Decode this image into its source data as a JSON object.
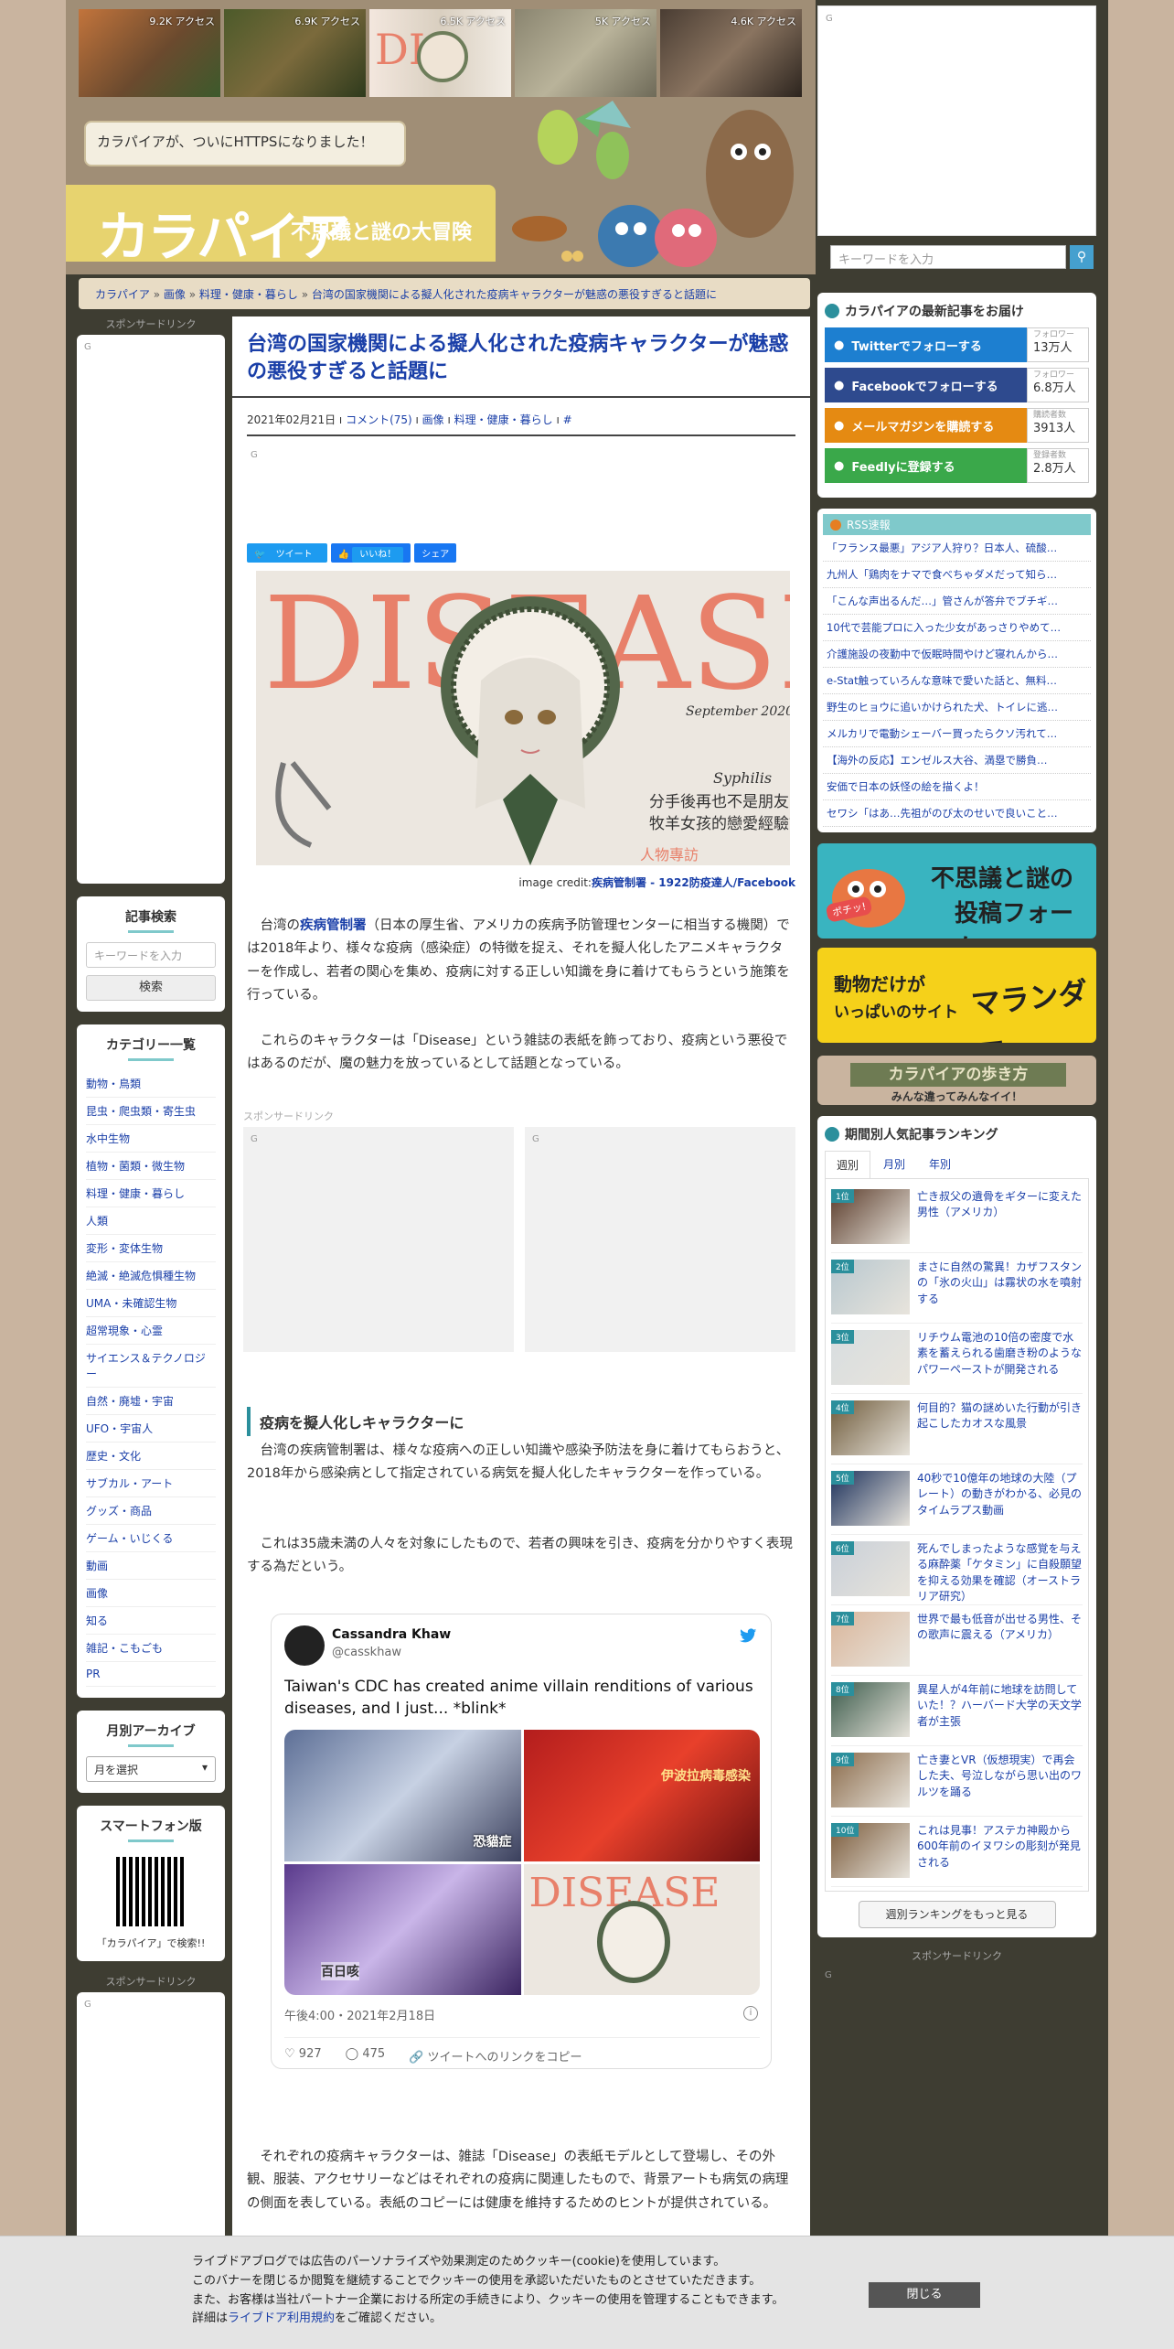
{
  "header": {
    "thumbs": [
      "9.2K アクセス",
      "6.9K アクセス",
      "6.5K アクセス",
      "5K アクセス",
      "4.6K アクセス"
    ],
    "bubble": "カラパイアが、ついにHTTPSになりました！",
    "logo": "カラパイア",
    "tagline": "不思議と謎の大冒険",
    "ad_g": "G",
    "search_placeholder": "キーワードを入力"
  },
  "breadcrumb": [
    "カラパイア",
    "画像",
    "料理・健康・暮らし",
    "台湾の国家機関による擬人化された疫病キャラクターが魅惑の悪役すぎると話題に"
  ],
  "left": {
    "sponsor": "スポンサードリンク",
    "ad_g": "G",
    "search_title": "記事検索",
    "search_placeholder": "キーワードを入力",
    "search_button": "検索",
    "category_title": "カテゴリー一覧",
    "categories": [
      "動物・鳥類",
      "昆虫・爬虫類・寄生虫",
      "水中生物",
      "植物・菌類・微生物",
      "料理・健康・暮らし",
      "人類",
      "変形・変体生物",
      "絶滅・絶滅危惧種生物",
      "UMA・未確認生物",
      "超常現象・心霊",
      "サイエンス＆テクノロジー",
      "自然・廃墟・宇宙",
      "UFO・宇宙人",
      "歴史・文化",
      "サブカル・アート",
      "グッズ・商品",
      "ゲーム・いじくる",
      "動画",
      "画像",
      "知る",
      "雑記・こもごも",
      "PR"
    ],
    "archive_title": "月別アーカイブ",
    "archive_select": "月を選択",
    "sp_title": "スマートフォン版",
    "sp_caption": "「カラパイア」で検索!!",
    "sponsor2": "スポンサードリンク"
  },
  "article": {
    "title": "台湾の国家機関による擬人化された疫病キャラクターが魅惑の悪役すぎると話題に",
    "date": "2021年02月21日",
    "comments": "コメント(75)",
    "cat1": "画像",
    "cat2": "料理・健康・暮らし",
    "hash": "#",
    "ad_g": "G",
    "tweet_btn": "ツイート",
    "like_btn": "いいね！",
    "share_btn": "シェア",
    "cover_title": "DISEASE",
    "cover_date": "September 2020",
    "cover_name": "Syphilis",
    "cover_line1": "分手後再也不是朋友",
    "cover_line2": "牧羊女孩的戀愛經驗談",
    "cover_tag": "人物專訪",
    "credit_prefix": "image credit:",
    "credit_link": "疾病管制署 - 1922防疫達人/Facebook",
    "p1_pre": "台湾の",
    "p1_link": "疾病管制署",
    "p1_rest": "（日本の厚生省、アメリカの疾病予防管理センターに相当する機関）では2018年より、様々な疫病（感染症）の特徴を捉え、それを擬人化したアニメキャラクターを作成し、若者の関心を集め、疫病に対する正しい知識を身に着けてもらうという施策を行っている。",
    "p2": "これらのキャラクターは「Disease」という雑誌の表紙を飾っており、疫病という悪役ではあるのだが、魔の魅力を放っているとして話題となっている。",
    "sponsor": "スポンサードリンク",
    "section": "疫病を擬人化しキャラクターに",
    "p3": "台湾の疾病管制署は、様々な疫病への正しい知識や感染予防法を身に着けてもらおうと、2018年から感染病として指定されている病気を擬人化したキャラクターを作っている。",
    "p4": "これは35歳未満の人々を対象にしたもので、若者の興味を引き、疫病を分かりやすく表現する為だという。",
    "p5": "それぞれの疫病キャラクターは、雑誌「Disease」の表紙モデルとして登場し、その外観、服装、アクセサリーなどはそれぞれの疫病に関連したもので、背景アートも病気の病理の側面を表している。表紙のコピーには健康を維持するためのヒントが提供されている。"
  },
  "tweet": {
    "name": "Cassandra Khaw",
    "handle": "@casskhaw",
    "text": "Taiwan's CDC has created anime villain renditions of various diseases, and I just... *blink*",
    "date": "午後4:00・2021年2月18日",
    "likes": "927",
    "replies": "475",
    "copy": "ツイートへのリンクをコピー",
    "img_text1": "恐貓症",
    "img_text2": "伊波拉病毒感染",
    "img_text3": "百日咳",
    "img_text4": "DISEASE"
  },
  "right": {
    "follow_title": "カラパイアの最新記事をお届け",
    "follow": [
      {
        "label": "Twitterでフォローする",
        "sub": "フォロワー",
        "count": "13万人",
        "color": "#1d7fd0"
      },
      {
        "label": "Facebookでフォローする",
        "sub": "フォロワー",
        "count": "6.8万人",
        "color": "#2e4a8e"
      },
      {
        "label": "メールマガジンを購読する",
        "sub": "購読者数",
        "count": "3913人",
        "color": "#e58a12"
      },
      {
        "label": "Feedlyに登録する",
        "sub": "登録者数",
        "count": "2.8万人",
        "color": "#3aa84a"
      }
    ],
    "rss_title": "RSS速報",
    "rss": [
      "「フランス最悪」アジア人狩り？日本人、硫酸…",
      "九州人「鶏肉をナマで食べちゃダメだって知ら…",
      "「こんな声出るんだ…」管さんが答弁でブチギ…",
      "10代で芸能プロに入った少女があっさりやめて…",
      "介護施設の夜勤中で仮眠時間やけど寝れんから…",
      "e-Stat触っていろんな意味で愛いた話と、無料…",
      "野生のヒョウに追いかけられた犬、トイレに逃…",
      "メルカリで電動シェーバー買ったらクソ汚れて…",
      "【海外の反応】エンゼルス大谷、満塁で勝負…",
      "安価で日本の妖怪の絵を描くよ！",
      "セワシ「はあ…先祖がのび太のせいで良いこと…"
    ],
    "banner1_line1": "不思議と謎の",
    "banner1_line2": "投稿フォーム",
    "banner1_badge": "ポチッ!",
    "banner2_line1": "動物だけが",
    "banner2_line2": "いっぱいのサイト",
    "banner2_logo": "マランダー",
    "walk_title": "カラパイアの歩き方",
    "walk_sub": "みんな違ってみんなイイ！",
    "ranking_title": "期間別人気記事ランキング",
    "tabs": [
      "週別",
      "月別",
      "年別"
    ],
    "ranking": [
      {
        "n": "1位",
        "t": "亡き叔父の遺骨をギターに変えた男性（アメリカ）"
      },
      {
        "n": "2位",
        "t": "まさに自然の驚異！カザフスタンの「氷の火山」は霧状の水を噴射する"
      },
      {
        "n": "3位",
        "t": "リチウム電池の10倍の密度で水素を蓄えられる歯磨き粉のようなパワーペーストが開発される"
      },
      {
        "n": "4位",
        "t": "何目的？猫の謎めいた行動が引き起こしたカオスな風景"
      },
      {
        "n": "5位",
        "t": "40秒で10億年の地球の大陸（プレート）の動きがわかる、必見のタイムラプス動画"
      },
      {
        "n": "6位",
        "t": "死んでしまったような感覚を与える麻酔薬「ケタミン」に自殺願望を抑える効果を確認（オーストラリア研究）"
      },
      {
        "n": "7位",
        "t": "世界で最も低音が出せる男性、その歌声に震える（アメリカ）"
      },
      {
        "n": "8位",
        "t": "異星人が4年前に地球を訪問していた！？ハーバード大学の天文学者が主張"
      },
      {
        "n": "9位",
        "t": "亡き妻とVR（仮想現実）で再会した夫、号泣しながら思い出のワルツを踊る"
      },
      {
        "n": "10位",
        "t": "これは見事！アステカ神殿から600年前のイヌワシの彫刻が発見される"
      }
    ],
    "more": "週別ランキングをもっと見る",
    "sponsor": "スポンサードリンク",
    "ad_g": "G"
  },
  "cookie": {
    "l1": "ライブドアブログでは広告のパーソナライズや効果測定のためクッキー(cookie)を使用しています。",
    "l2": "このバナーを閉じるか閲覧を継続することでクッキーの使用を承認いただいたものとさせていただきます。",
    "l3": "また、お客様は当社パートナー企業における所定の手続きにより、クッキーの使用を管理することもできます。",
    "l4_pre": "詳細は",
    "l4_link": "ライブドア利用規約",
    "l4_post": "をご確認ください。",
    "close": "閉じる"
  }
}
